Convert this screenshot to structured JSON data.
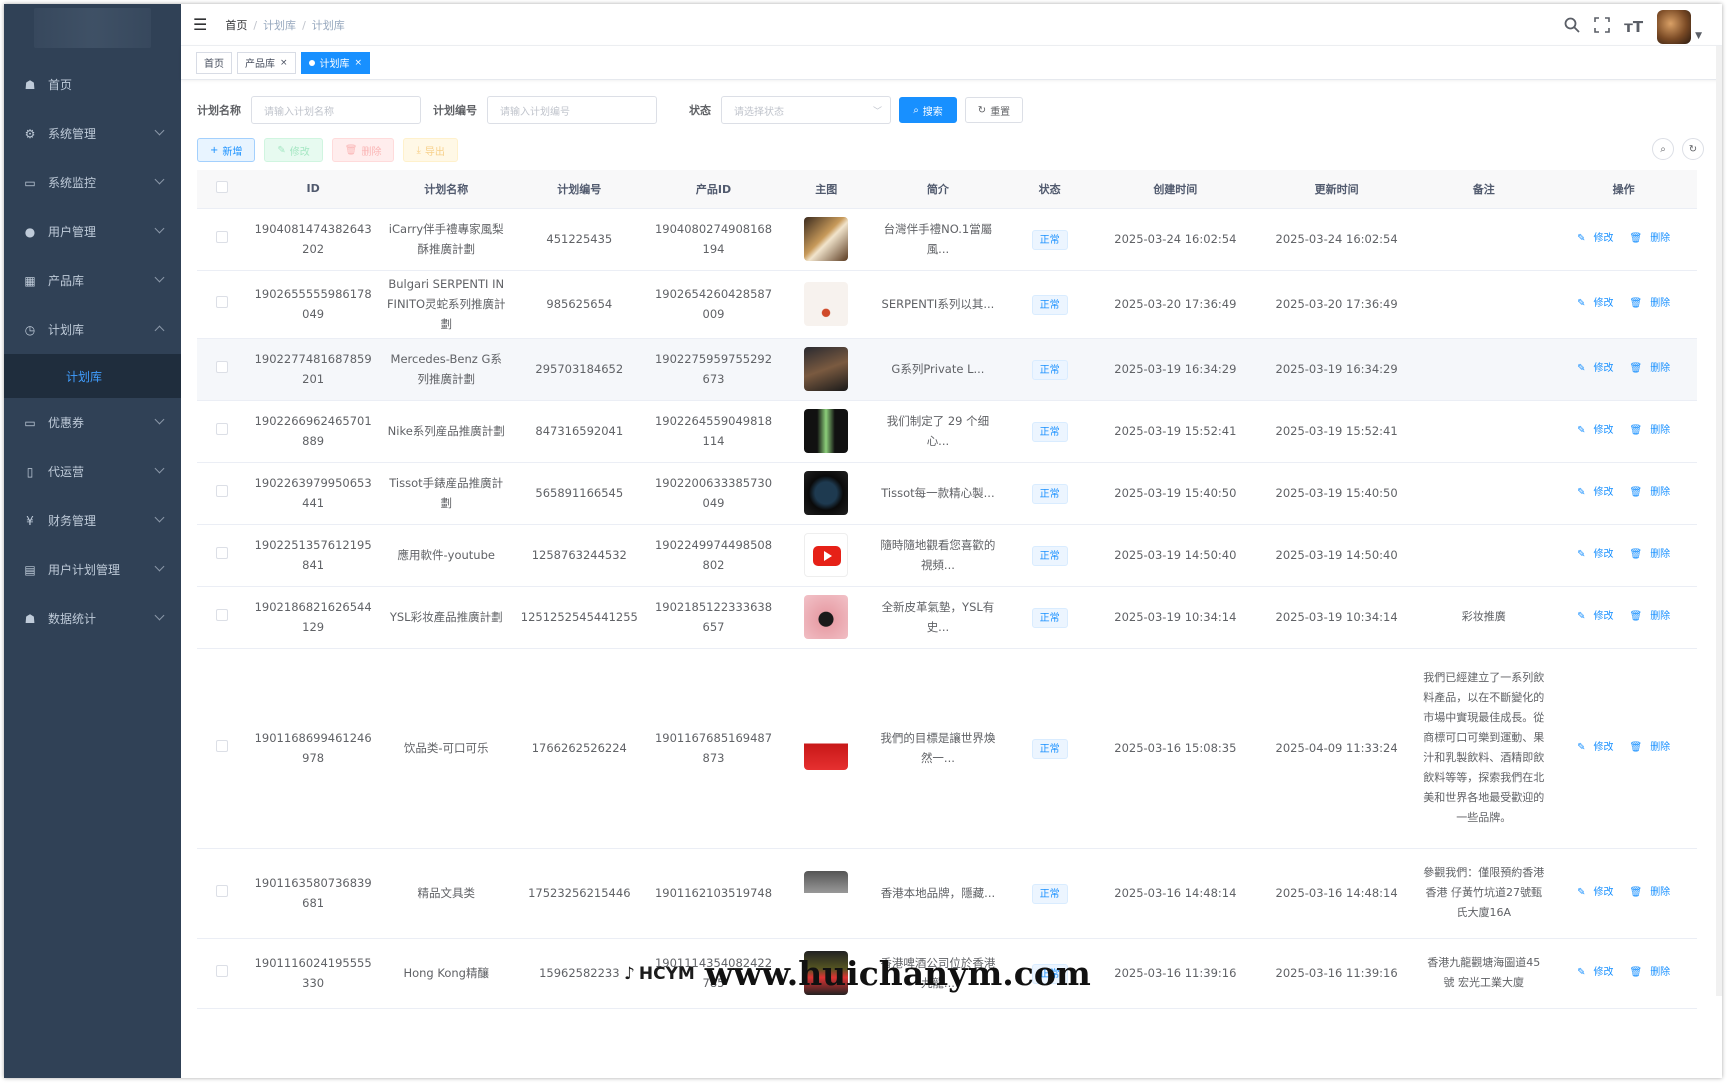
{
  "sidebar": {
    "items": [
      {
        "label": "首页",
        "icon": "dashboard-icon",
        "glyph": "☗",
        "expandable": false
      },
      {
        "label": "系统管理",
        "icon": "settings-icon",
        "glyph": "⚙",
        "expandable": true
      },
      {
        "label": "系统监控",
        "icon": "monitor-icon",
        "glyph": "▭",
        "expandable": true
      },
      {
        "label": "用户管理",
        "icon": "user-icon",
        "glyph": "●",
        "expandable": true
      },
      {
        "label": "产品库",
        "icon": "cart-icon",
        "glyph": "▦",
        "expandable": true
      },
      {
        "label": "计划库",
        "icon": "clock-icon",
        "glyph": "◷",
        "expandable": true,
        "open": true
      }
    ],
    "submenu_active": "计划库",
    "items2": [
      {
        "label": "优惠券",
        "icon": "coupon-icon",
        "glyph": "▭"
      },
      {
        "label": "代运营",
        "icon": "operation-icon",
        "glyph": "▯"
      },
      {
        "label": "财务管理",
        "icon": "finance-icon",
        "glyph": "¥"
      },
      {
        "label": "用户计划管理",
        "icon": "plan-icon",
        "glyph": "▤"
      },
      {
        "label": "数据统计",
        "icon": "stats-icon",
        "glyph": "☗"
      }
    ]
  },
  "navbar": {
    "breadcrumb": [
      "首页",
      "计划库",
      "计划库"
    ]
  },
  "tags": [
    {
      "label": "首页",
      "active": false,
      "closable": false
    },
    {
      "label": "产品库",
      "active": false,
      "closable": true
    },
    {
      "label": "计划库",
      "active": true,
      "closable": true
    }
  ],
  "search": {
    "name_label": "计划名称",
    "name_placeholder": "请输入计划名称",
    "code_label": "计划编号",
    "code_placeholder": "请输入计划编号",
    "status_label": "状态",
    "status_placeholder": "请选择状态",
    "search_btn": "搜索",
    "reset_btn": "重置"
  },
  "toolbar": {
    "add": "新增",
    "edit": "修改",
    "delete": "删除",
    "export": "导出"
  },
  "table": {
    "headers": [
      "ID",
      "计划名称",
      "计划编号",
      "产品ID",
      "主图",
      "简介",
      "状态",
      "创建时间",
      "更新时间",
      "备注",
      "操作"
    ],
    "edit_label": "修改",
    "delete_label": "删除",
    "rows": [
      {
        "id": "1904081474382643202",
        "name": "iCarry伴手禮專家風梨酥推廣計劃",
        "code": "451225435",
        "pid": "1904080274908168194",
        "intro": "台灣伴手禮NO.1當屬風...",
        "status": "正常",
        "created": "2025-03-24 16:02:54",
        "updated": "2025-03-24 16:02:54",
        "remark": "",
        "thumb": "snack"
      },
      {
        "id": "1902655555986178049",
        "name": "Bulgari SERPENTI INFINITO灵蛇系列推廣計劃",
        "code": "985625654",
        "pid": "1902654260428587009",
        "intro": "SERPENTI系列以其...",
        "status": "正常",
        "created": "2025-03-20 17:36:49",
        "updated": "2025-03-20 17:36:49",
        "remark": "",
        "thumb": "necklace"
      },
      {
        "id": "1902277481687859201",
        "name": "Mercedes-Benz G系列推廣計劃",
        "code": "295703184652",
        "pid": "1902275959755292673",
        "intro": "G系列Private L...",
        "status": "正常",
        "created": "2025-03-19 16:34:29",
        "updated": "2025-03-19 16:34:29",
        "remark": "",
        "thumb": "car"
      },
      {
        "id": "1902266962465701889",
        "name": "Nike系列産品推廣計劃",
        "code": "847316592041",
        "pid": "1902264559049818114",
        "intro": "我们制定了 29 个细心...",
        "status": "正常",
        "created": "2025-03-19 15:52:41",
        "updated": "2025-03-19 15:52:41",
        "remark": "",
        "thumb": "nike"
      },
      {
        "id": "1902263979950653441",
        "name": "Tissot手錶産品推廣計劃",
        "code": "565891166545",
        "pid": "1902200633385730049",
        "intro": "Tissot每一款精心製...",
        "status": "正常",
        "created": "2025-03-19 15:40:50",
        "updated": "2025-03-19 15:40:50",
        "remark": "",
        "thumb": "watch"
      },
      {
        "id": "1902251357612195841",
        "name": "應用軟件-youtube",
        "code": "1258763244532",
        "pid": "1902249974498508802",
        "intro": "隨時隨地觀看您喜歡的視頻...",
        "status": "正常",
        "created": "2025-03-19 14:50:40",
        "updated": "2025-03-19 14:50:40",
        "remark": "",
        "thumb": "youtube"
      },
      {
        "id": "1902186821626544129",
        "name": "YSL彩妆產品推廣計劃",
        "code": "1251252545441255",
        "pid": "1902185122333638657",
        "intro": "全新皮革氣墊，YSL有史...",
        "status": "正常",
        "created": "2025-03-19 10:34:14",
        "updated": "2025-03-19 10:34:14",
        "remark": "彩妆推廣",
        "thumb": "ysl"
      },
      {
        "id": "1901168699461246978",
        "name": "饮品类-可口可乐",
        "code": "1766262526224",
        "pid": "1901167685169487873",
        "intro": "我們的目標是讓世界煥然一...",
        "status": "正常",
        "created": "2025-03-16 15:08:35",
        "updated": "2025-04-09 11:33:24",
        "remark": "我們已經建立了一系列飲料產品，以在不斷變化的市場中實現最佳成長。從商標可口可樂到運動、果汁和乳製飲料、酒精即飲飲料等等，探索我們在北美和世界各地最受歡迎的一些品牌。",
        "thumb": "coke"
      },
      {
        "id": "1901163580736839681",
        "name": "精品文具类",
        "code": "17523256215446",
        "pid": "1901162103519748",
        "intro": "香港本地品牌，隱藏...",
        "status": "正常",
        "created": "2025-03-16 14:48:14",
        "updated": "2025-03-16 14:48:14",
        "remark": "參觀我們：僅限預約香港香港 仔黃竹坑道27號甄氏大廈16A",
        "thumb": "stationery"
      },
      {
        "id": "1901116024195555330",
        "name": "Hong Kong精釀",
        "code": "15962582233",
        "pid": "1901114354082422785",
        "intro": "香港啤酒公司位於香港九龍...",
        "status": "正常",
        "created": "2025-03-16 11:39:16",
        "updated": "2025-03-16 11:39:16",
        "remark": "香港九龍觀塘海圖道45號 宏光工業大廈",
        "thumb": "beer"
      }
    ]
  },
  "watermark": {
    "logo": "HCYM",
    "url": "www.huichanym.com"
  },
  "colors": {
    "sidebar": "#304156",
    "accent": "#1890ff",
    "submenu": "#1f2d3d"
  }
}
